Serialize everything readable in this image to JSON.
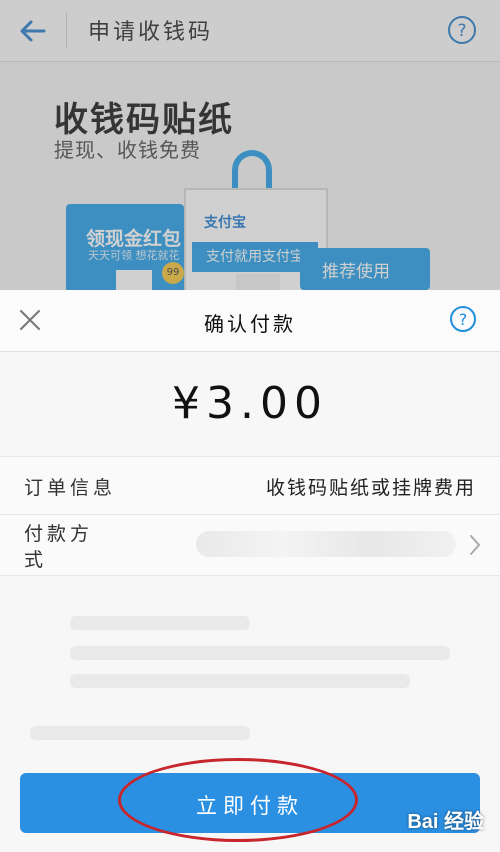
{
  "background_page": {
    "title": "申请收钱码",
    "banner": {
      "title": "收钱码贴纸",
      "subtitle": "提现、收钱免费",
      "card_left_line1": "领现金红包",
      "card_left_line2": "天天可领 想花就花",
      "card_mid_brand": "支付宝",
      "card_mid_label": "支付就用支付宝",
      "card_right_label": "推荐使用"
    }
  },
  "sheet": {
    "title": "确认付款",
    "amount": "¥3.00",
    "order_label": "订单信息",
    "order_value": "收钱码贴纸或挂牌费用",
    "method_label": "付款方式",
    "pay_button_label": "立即付款"
  },
  "watermark": "Bai 经验",
  "colors": {
    "accent": "#2c90e2",
    "annotation": "#c7262d"
  }
}
